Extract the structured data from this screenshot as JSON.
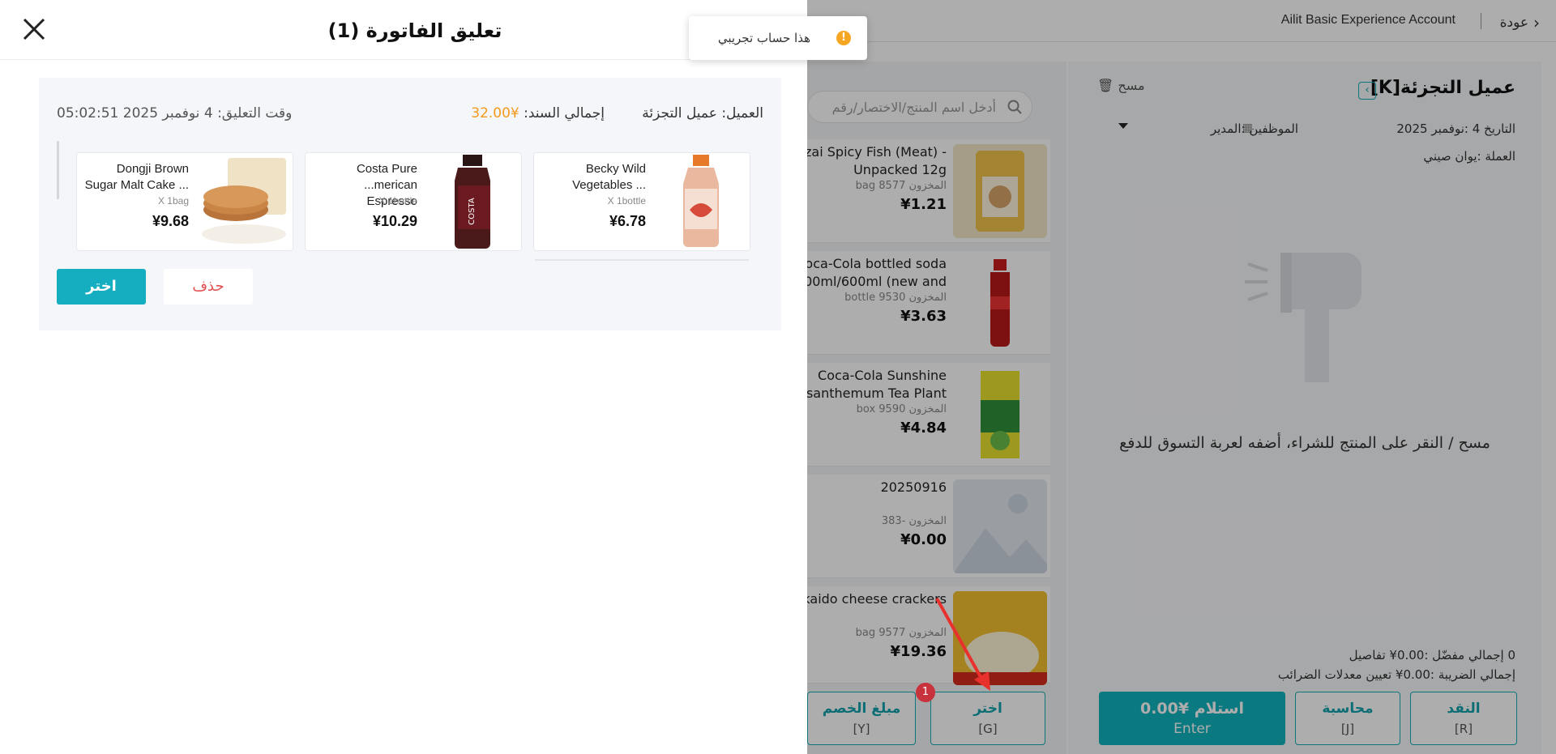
{
  "background": {
    "topbar": {
      "back_label": "عودة",
      "account_name": "Ailit Basic Experience Account"
    },
    "search": {
      "placeholder": "أدخل اسم المنتج/الاختصار/رقم"
    },
    "products": [
      {
        "name": "zai Spicy Fish (Meat) -",
        "name2": "Unpacked 12g",
        "stock": "المخزون 8577 bag",
        "price": "¥1.21",
        "image": "spicy-fish-package"
      },
      {
        "name": "oca-Cola bottled soda",
        "name2": "00ml/600ml (new and",
        "stock": "المخزون 9530 bottle",
        "price": "¥3.63",
        "image": "coca-cola-bottle"
      },
      {
        "name": "Coca-Cola Sunshine",
        "name2": "ysanthemum Tea Plant",
        "stock": "المخزون 9590 box",
        "price": "¥4.84",
        "image": "tea-box"
      },
      {
        "name": "20250916",
        "name2": "",
        "stock": "المخزون -383",
        "price": "¥0.00",
        "image": "placeholder-image"
      },
      {
        "name": "kaido cheese crackers",
        "name2": "",
        "stock": "المخزون 9577 bag",
        "price": "¥19.36",
        "image": "crackers"
      }
    ],
    "cart": {
      "title": "عميل التجزئة[K]",
      "clear_label": "مسح",
      "date": "التاريخ   4 :نوفمبر 2025",
      "staff": "الموظفين   :المدير",
      "currency": "العملة   :يوان صيني",
      "empty_text": "مسح / النقر على المنتج للشراء، أضفه لعربة التسوق للدفع",
      "totals_line1": "0  إجمالي   مفضّل  :0.00¥   تفاصيل",
      "totals_line2": "إجمالي الضريبة  :0.00¥   تعيين معدلات الضرائب"
    },
    "bottom_buttons": [
      {
        "label": "مبلغ الخصم",
        "key": "[Y]"
      },
      {
        "label": "اختر",
        "key": "[G]"
      },
      {
        "label": "محاسبة",
        "key": "[J]"
      },
      {
        "label": "النقد",
        "key": "[R]"
      }
    ],
    "pay_button": {
      "label": "استلام ¥0.00",
      "key": "Enter"
    },
    "badge_count": "1"
  },
  "toast": {
    "text": "هذا حساب تجريبي"
  },
  "drawer": {
    "title": "تعليق الفاتورة (1)",
    "order": {
      "customer_label": "العميل:",
      "customer_value": "عميل التجزئة",
      "total_label": "إجمالي السند:",
      "total_value": "¥32.00",
      "time_label": "وقت التعليق:",
      "time_value": "4 نوفمبر 2025 05:02:51",
      "items": [
        {
          "name": "Becky Wild Vegetables ...",
          "qty": "X  1bottle",
          "price": "¥6.78",
          "image": "tea-bottle"
        },
        {
          "name": "Costa Pure ...merican Espresso",
          "qty": "X  1bottle",
          "price": "¥10.29",
          "image": "costa-bottle"
        },
        {
          "name": "Dongji Brown Sugar Malt Cake ...",
          "qty": "X  1bag",
          "price": "¥9.68",
          "image": "malt-cakes"
        }
      ],
      "select_label": "اختر",
      "delete_label": "حذف"
    }
  },
  "colors": {
    "accent": "#15aec0",
    "price_highlight": "#f39a1b",
    "delete_red": "#e25050",
    "badge_red": "#c7323c"
  }
}
